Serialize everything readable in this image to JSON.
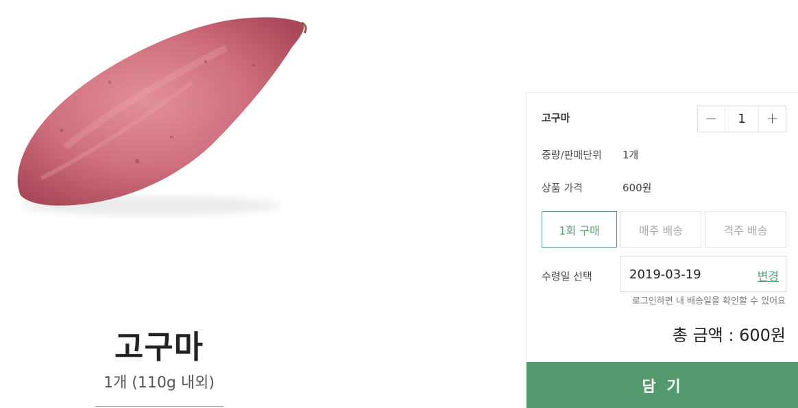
{
  "product": {
    "title": "고구마",
    "subtitle": "1개 (110g 내외)",
    "image_icon": "sweet-potato-image"
  },
  "panel": {
    "name": "고구마",
    "quantity": {
      "minus": "−",
      "value": "1",
      "plus": "+"
    },
    "weight": {
      "label": "중량/판매단위",
      "value": "1개"
    },
    "price": {
      "label": "상품 가격",
      "value": "600원"
    },
    "options": [
      {
        "label": "1회 구매",
        "selected": true
      },
      {
        "label": "매주 배송",
        "selected": false
      },
      {
        "label": "격주 배송",
        "selected": false
      }
    ],
    "date": {
      "label": "수령일 선택",
      "value": "2019-03-19",
      "change": "변경",
      "hint": "로그인하면 내 배송일을 확인할 수 있어요"
    },
    "total": "총 금액 : 600원",
    "add_button": "담 기"
  },
  "colors": {
    "accent": "#549a6e",
    "selected_border": "#5b9e72",
    "potato_skin": "#c86a78"
  }
}
